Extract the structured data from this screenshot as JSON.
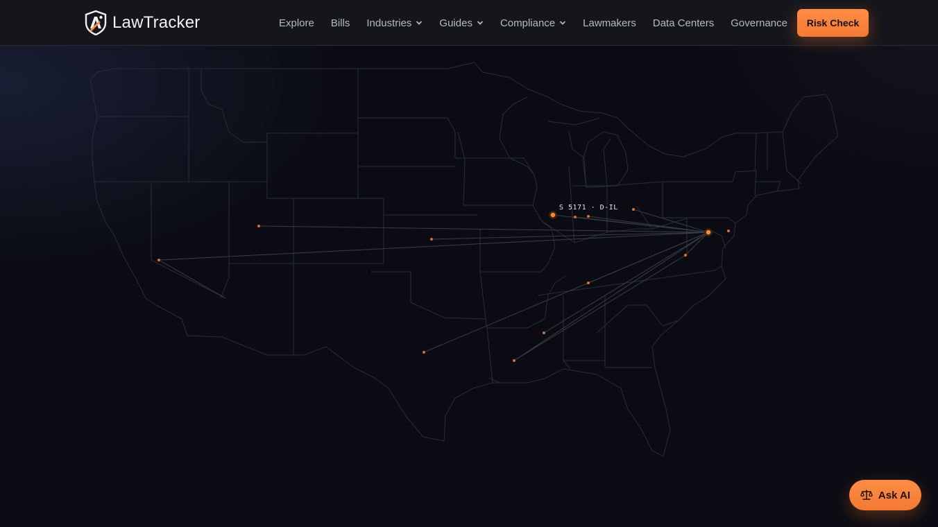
{
  "header": {
    "brand": "LawTracker",
    "nav": [
      {
        "label": "Explore",
        "dropdown": false
      },
      {
        "label": "Bills",
        "dropdown": false
      },
      {
        "label": "Industries",
        "dropdown": true
      },
      {
        "label": "Guides",
        "dropdown": true
      },
      {
        "label": "Compliance",
        "dropdown": true
      },
      {
        "label": "Lawmakers",
        "dropdown": false
      },
      {
        "label": "Data Centers",
        "dropdown": false
      },
      {
        "label": "Governance",
        "dropdown": false
      }
    ],
    "cta_label": "Risk Check"
  },
  "map": {
    "highlight_label": "S 5171 · D-IL",
    "accent_color": "#ff8a3d"
  },
  "ask_ai": {
    "label": "Ask AI",
    "icon": "scale-icon"
  },
  "colors": {
    "background": "#0b0c13",
    "header": "#15161c",
    "accent": "#ff8a3d"
  }
}
